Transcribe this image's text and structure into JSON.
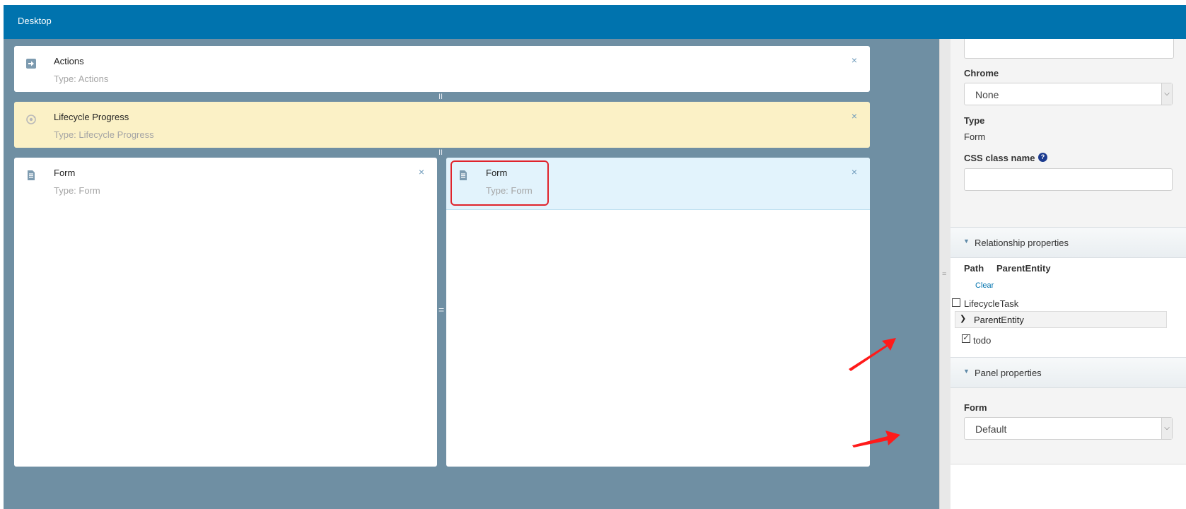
{
  "header": {
    "title": "Desktop"
  },
  "canvas": {
    "panes": [
      {
        "id": "actions",
        "name": "Actions",
        "type": "Type: Actions"
      },
      {
        "id": "lifecycle",
        "name": "Lifecycle Progress",
        "type": "Type: Lifecycle Progress"
      },
      {
        "id": "form-left",
        "name": "Form",
        "type": "Type: Form"
      },
      {
        "id": "form-right",
        "name": "Form",
        "type": "Type: Form"
      }
    ],
    "close_glyph": "×",
    "splitter_glyph": "=",
    "splitter_v_glyph": "II"
  },
  "properties": {
    "chrome_label": "Chrome",
    "chrome_value": "None",
    "type_label": "Type",
    "type_value": "Form",
    "css_label": "CSS class name",
    "css_help": "?",
    "css_value": "",
    "relationship": {
      "title": "Relationship properties",
      "path_label": "Path",
      "path_value": "ParentEntity",
      "clear_label": "Clear",
      "items": [
        {
          "label": "LifecycleTask",
          "checked": false
        },
        {
          "label": "todo",
          "checked": true
        }
      ],
      "node_label": "ParentEntity"
    },
    "panel": {
      "title": "Panel properties",
      "form_label": "Form",
      "form_value": "Default"
    }
  },
  "colors": {
    "brand": "#0073ae",
    "canvas": "#6f8fa3",
    "highlight": "#e0232b",
    "lifecycle_bg": "#fbf1c6",
    "selected_bg": "#e2f3fc"
  }
}
